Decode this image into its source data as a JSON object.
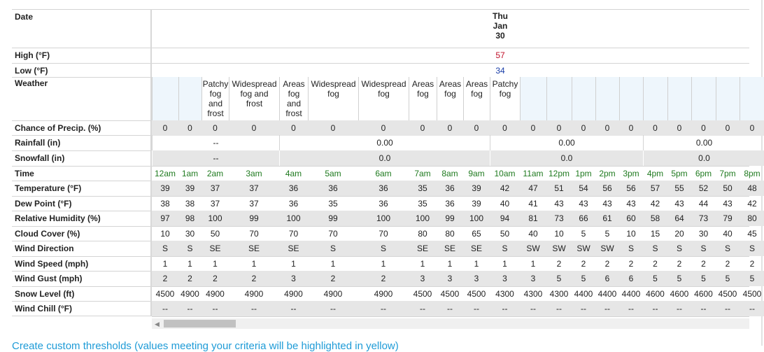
{
  "labels": {
    "date": "Date",
    "high": "High (°F)",
    "low": "Low (°F)",
    "weather": "Weather",
    "precip_chance": "Chance of Precip. (%)",
    "rainfall": "Rainfall (in)",
    "snowfall": "Snowfall (in)",
    "time": "Time",
    "temperature": "Temperature (°F)",
    "dew_point": "Dew Point (°F)",
    "humidity": "Relative Humidity (%)",
    "cloud_cover": "Cloud Cover (%)",
    "wind_direction": "Wind Direction",
    "wind_speed": "Wind Speed (mph)",
    "wind_gust": "Wind Gust (mph)",
    "snow_level": "Snow Level (ft)",
    "wind_chill": "Wind Chill (°F)"
  },
  "day": {
    "line1": "Thu",
    "line2": "Jan",
    "line3": "30",
    "high": "57",
    "low": "34"
  },
  "hours": [
    "12am",
    "1am",
    "2am",
    "3am",
    "4am",
    "5am",
    "6am",
    "7am",
    "8am",
    "9am",
    "10am",
    "11am",
    "12pm",
    "1pm",
    "2pm",
    "3pm",
    "4pm",
    "5pm",
    "6pm",
    "7pm",
    "8pm"
  ],
  "weather": [
    [],
    [],
    [
      "Patchy",
      "fog",
      "and",
      "frost"
    ],
    [
      "Widespread",
      "fog and",
      "frost"
    ],
    [
      "Areas",
      "fog",
      "and",
      "frost"
    ],
    [
      "Widespread",
      "fog"
    ],
    [
      "Widespread",
      "fog"
    ],
    [
      "Areas",
      "fog"
    ],
    [
      "Areas",
      "fog"
    ],
    [
      "Areas",
      "fog"
    ],
    [
      "Patchy",
      "fog"
    ],
    [],
    [],
    [],
    [],
    [],
    [],
    [],
    [],
    [],
    []
  ],
  "precip_chance": [
    "0",
    "0",
    "0",
    "0",
    "0",
    "0",
    "0",
    "0",
    "0",
    "0",
    "0",
    "0",
    "0",
    "0",
    "0",
    "0",
    "0",
    "0",
    "0",
    "0",
    "0"
  ],
  "rainfall_groups": [
    "--",
    "0.00",
    "0.00",
    "0.00"
  ],
  "snowfall_groups": [
    "--",
    "0.0",
    "0.0",
    "0.0"
  ],
  "temperature": [
    "39",
    "39",
    "37",
    "37",
    "36",
    "36",
    "36",
    "35",
    "36",
    "39",
    "42",
    "47",
    "51",
    "54",
    "56",
    "56",
    "57",
    "55",
    "52",
    "50",
    "48"
  ],
  "dew_point": [
    "38",
    "38",
    "37",
    "37",
    "36",
    "35",
    "36",
    "35",
    "36",
    "39",
    "40",
    "41",
    "43",
    "43",
    "43",
    "43",
    "42",
    "43",
    "44",
    "43",
    "42"
  ],
  "humidity": [
    "97",
    "98",
    "100",
    "99",
    "100",
    "99",
    "100",
    "100",
    "99",
    "100",
    "94",
    "81",
    "73",
    "66",
    "61",
    "60",
    "58",
    "64",
    "73",
    "79",
    "80"
  ],
  "cloud_cover": [
    "10",
    "30",
    "50",
    "70",
    "70",
    "70",
    "70",
    "80",
    "80",
    "65",
    "50",
    "40",
    "10",
    "5",
    "5",
    "10",
    "15",
    "20",
    "30",
    "40",
    "45"
  ],
  "wind_direction": [
    "S",
    "S",
    "SE",
    "SE",
    "SE",
    "S",
    "S",
    "SE",
    "SE",
    "SE",
    "S",
    "SW",
    "SW",
    "SW",
    "SW",
    "S",
    "S",
    "S",
    "S",
    "S",
    "S"
  ],
  "wind_speed": [
    "1",
    "1",
    "1",
    "1",
    "1",
    "1",
    "1",
    "1",
    "1",
    "1",
    "1",
    "1",
    "2",
    "2",
    "2",
    "2",
    "2",
    "2",
    "2",
    "2",
    "2"
  ],
  "wind_gust": [
    "2",
    "2",
    "2",
    "2",
    "3",
    "2",
    "2",
    "3",
    "3",
    "3",
    "3",
    "3",
    "5",
    "5",
    "6",
    "6",
    "5",
    "5",
    "5",
    "5",
    "5"
  ],
  "snow_level": [
    "4500",
    "4900",
    "4900",
    "4900",
    "4900",
    "4900",
    "4900",
    "4500",
    "4500",
    "4500",
    "4300",
    "4300",
    "4300",
    "4400",
    "4400",
    "4400",
    "4600",
    "4600",
    "4600",
    "4500",
    "4500"
  ],
  "wind_chill": [
    "--",
    "--",
    "--",
    "--",
    "--",
    "--",
    "--",
    "--",
    "--",
    "--",
    "--",
    "--",
    "--",
    "--",
    "--",
    "--",
    "--",
    "--",
    "--",
    "--",
    "--"
  ],
  "footer_link": "Create custom thresholds (values meeting your criteria will be highlighted in yellow)"
}
